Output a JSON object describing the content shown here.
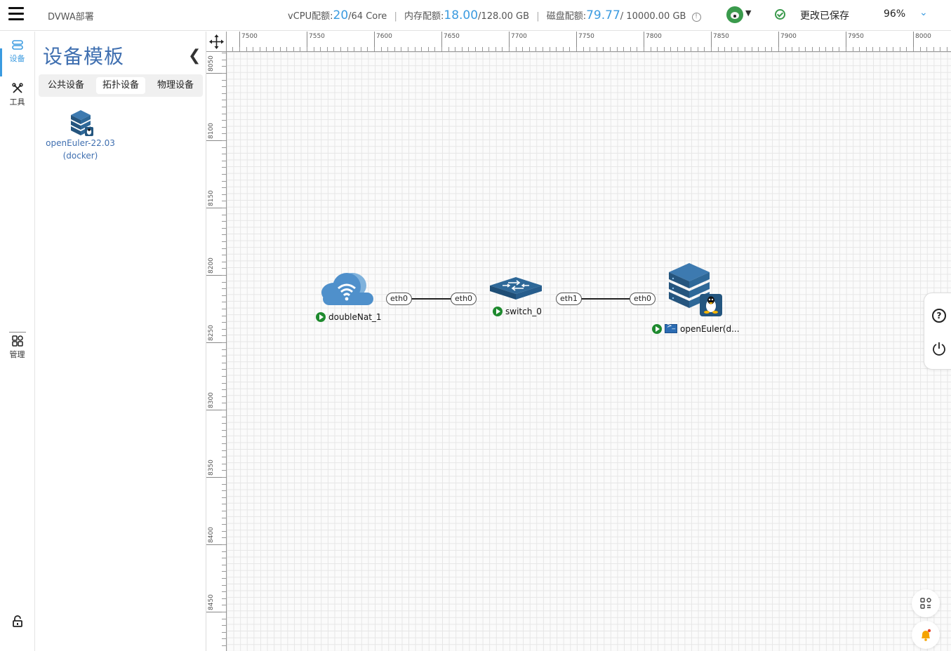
{
  "header": {
    "app_title": "DVWA部署",
    "vcpu_label": "vCPU配额:",
    "vcpu_used": "20",
    "vcpu_total": "/64 Core",
    "mem_label": "内存配额:",
    "mem_used": "18.00",
    "mem_total": "/128.00 GB",
    "disk_label": "磁盘配额:",
    "disk_used": "79.77",
    "disk_total": "/ 10000.00 GB",
    "separator": "|",
    "save_status": "更改已保存",
    "zoom": "96%",
    "info_glyph": "!",
    "accent_color": "#3b9be0"
  },
  "rail": {
    "items": [
      {
        "label": "设备",
        "icon": "device-icon"
      },
      {
        "label": "工具",
        "icon": "tools-icon"
      },
      {
        "label": "管理",
        "icon": "manage-icon"
      }
    ],
    "lock_icon": "lock-icon"
  },
  "panel": {
    "title": "设备模板",
    "tabs": [
      "公共设备",
      "拓扑设备",
      "物理设备"
    ],
    "active_tab": 1,
    "devices": [
      {
        "name_line1": "openEuler-22.03",
        "name_line2": "(docker)",
        "icon": "server-linux-icon"
      }
    ]
  },
  "canvas": {
    "ruler_x": [
      "7500",
      "7550",
      "7600",
      "7650",
      "7700",
      "7750",
      "7800",
      "7850",
      "7900",
      "7950",
      "8000"
    ],
    "ruler_y": [
      "8050",
      "8100",
      "8150",
      "8200",
      "8250",
      "8300",
      "8350",
      "8400",
      "8450"
    ],
    "nodes": [
      {
        "name": "doubleNat_1",
        "icon": "cloud-nat-icon",
        "status": "running"
      },
      {
        "name": "switch_0",
        "icon": "switch-icon",
        "status": "running"
      },
      {
        "name": "openEuler(d...",
        "icon": "server-linux-icon",
        "status": "running"
      }
    ],
    "ports": [
      "eth0",
      "eth0",
      "eth1",
      "eth0"
    ],
    "float_buttons": [
      "help-icon",
      "power-icon"
    ],
    "help_glyph": "?"
  }
}
